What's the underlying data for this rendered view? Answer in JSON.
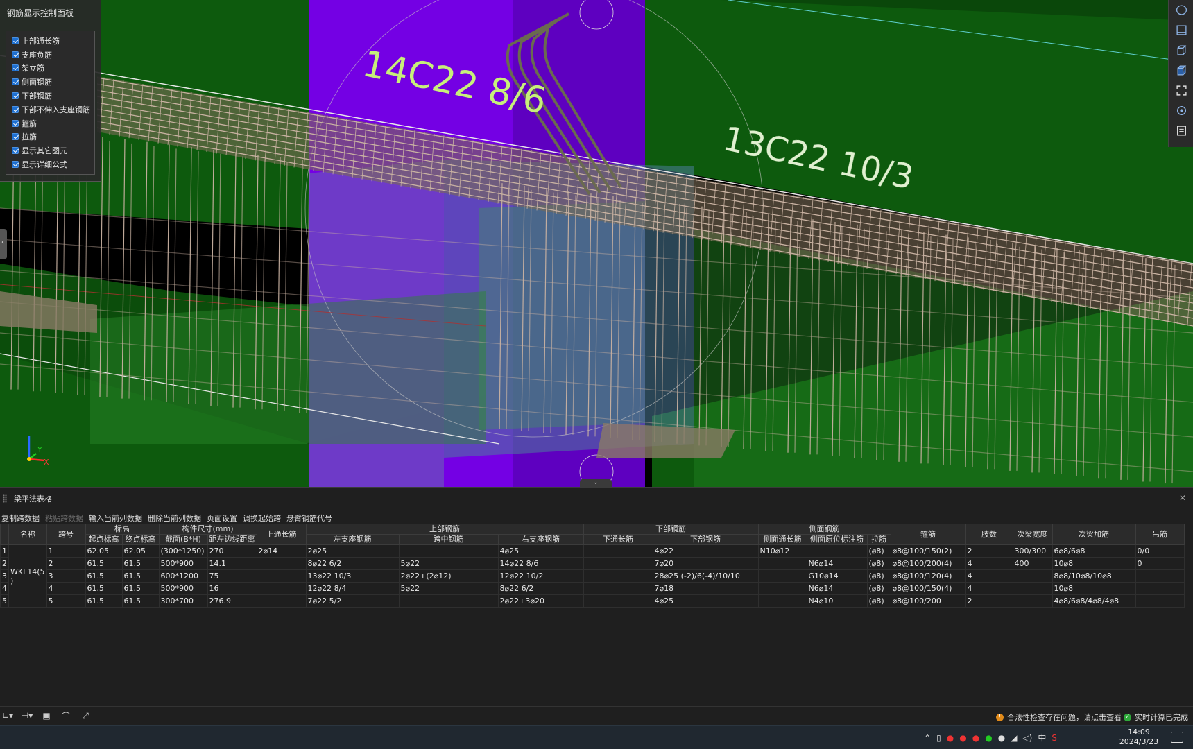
{
  "control_panel": {
    "title": "钢筋显示控制面板",
    "items": [
      {
        "label": "上部通长筋"
      },
      {
        "label": "支座负筋"
      },
      {
        "label": "架立筋"
      },
      {
        "label": "侧面钢筋"
      },
      {
        "label": "下部钢筋"
      },
      {
        "label": "下部不伸入支座钢筋"
      },
      {
        "label": "箍筋"
      },
      {
        "label": "拉筋"
      },
      {
        "label": "显示其它图元"
      },
      {
        "label": "显示详细公式"
      }
    ]
  },
  "viewport": {
    "label_left": "14C22 8/6",
    "label_right": "13C22 10/3",
    "axis": {
      "y": "Y",
      "x": "X"
    }
  },
  "right_toolbar": {
    "icons": [
      "orbit-icon",
      "view-top-icon",
      "view-3d-icon",
      "view-box-icon",
      "fit-screen-icon",
      "settings-cube-icon",
      "report-icon"
    ]
  },
  "table_panel": {
    "title": "梁平法表格",
    "toolbar": [
      {
        "label": "复制跨数据",
        "enabled": true
      },
      {
        "label": "粘贴跨数据",
        "enabled": false
      },
      {
        "label": "输入当前列数据",
        "enabled": true
      },
      {
        "label": "删除当前列数据",
        "enabled": true
      },
      {
        "label": "页面设置",
        "enabled": true
      },
      {
        "label": "调换起始跨",
        "enabled": true
      },
      {
        "label": "悬臂钢筋代号",
        "enabled": true
      }
    ],
    "group_headers": {
      "name": "名称",
      "span": "跨号",
      "elevation": "标高",
      "size": "构件尺寸(mm)",
      "top_through": "上通长筋",
      "top_rebar": "上部钢筋",
      "bottom_rebar": "下部钢筋",
      "side_rebar": "侧面钢筋",
      "stirrup": "箍筋",
      "legs": "肢数",
      "sec_width": "次梁宽度",
      "sec_add": "次梁加筋",
      "hanger": "吊筋"
    },
    "sub_headers": {
      "start_elev": "起点标高",
      "end_elev": "终点标高",
      "section": "截面(B*H)",
      "edge_dist": "距左边线距离",
      "left_support": "左支座钢筋",
      "mid_span": "跨中钢筋",
      "right_support": "右支座钢筋",
      "bottom_through": "下通长筋",
      "bottom_main": "下部钢筋",
      "side_through": "侧面通长筋",
      "side_original": "侧面原位标注筋",
      "tie": "拉筋"
    },
    "beam_name": "WKL14(5",
    "beam_name_suffix": ")",
    "row_markers": [
      "1",
      "2",
      "3",
      "4",
      "5"
    ],
    "rows": [
      {
        "span": "1",
        "start": "62.05",
        "end": "62.05",
        "section": "(300*1250)",
        "edge": "270",
        "top_through": "2⌀14",
        "left": "2⌀25",
        "mid": "",
        "right": "4⌀25",
        "bot_through": "",
        "bot": "4⌀22",
        "side_through": "N10⌀12",
        "side_orig": "",
        "tie": "(⌀8)",
        "stirrup": "⌀8@100/150(2)",
        "legs": "2",
        "sec_w": "300/300",
        "sec_add": "6⌀8/6⌀8",
        "hanger": "0/0"
      },
      {
        "span": "2",
        "start": "61.5",
        "end": "61.5",
        "section": "500*900",
        "edge": "14.1",
        "top_through": "",
        "left": "8⌀22 6/2",
        "mid": "5⌀22",
        "right": "14⌀22 8/6",
        "bot_through": "",
        "bot": "7⌀20",
        "side_through": "",
        "side_orig": "N6⌀14",
        "tie": "(⌀8)",
        "stirrup": "⌀8@100/200(4)",
        "legs": "4",
        "sec_w": "400",
        "sec_add": "10⌀8",
        "hanger": "0"
      },
      {
        "span": "3",
        "start": "61.5",
        "end": "61.5",
        "section": "600*1200",
        "edge": "75",
        "top_through": "",
        "left": "13⌀22 10/3",
        "mid": "2⌀22+(2⌀12)",
        "right": "12⌀22 10/2",
        "bot_through": "",
        "bot": "28⌀25 (-2)/6(-4)/10/10",
        "side_through": "",
        "side_orig": "G10⌀14",
        "tie": "(⌀8)",
        "stirrup": "⌀8@100/120(4)",
        "legs": "4",
        "sec_w": "",
        "sec_add": "8⌀8/10⌀8/10⌀8",
        "hanger": ""
      },
      {
        "span": "4",
        "start": "61.5",
        "end": "61.5",
        "section": "500*900",
        "edge": "16",
        "top_through": "",
        "left": "12⌀22 8/4",
        "mid": "5⌀22",
        "right": "8⌀22 6/2",
        "bot_through": "",
        "bot": "7⌀18",
        "side_through": "",
        "side_orig": "N6⌀14",
        "tie": "(⌀8)",
        "stirrup": "⌀8@100/150(4)",
        "legs": "4",
        "sec_w": "",
        "sec_add": "10⌀8",
        "hanger": ""
      },
      {
        "span": "5",
        "start": "61.5",
        "end": "61.5",
        "section": "300*700",
        "edge": "276.9",
        "top_through": "",
        "left": "7⌀22 5/2",
        "mid": "",
        "right": "2⌀22+3⌀20",
        "bot_through": "",
        "bot": "4⌀25",
        "side_through": "",
        "side_orig": "N4⌀10",
        "tie": "(⌀8)",
        "stirrup": "⌀8@100/200",
        "legs": "2",
        "sec_w": "",
        "sec_add": "4⌀8/6⌀8/4⌀8/4⌀8",
        "hanger": ""
      }
    ]
  },
  "status": {
    "warning": "合法性检查存在问题，请点击查看",
    "ok": "实时计算已完成"
  },
  "taskbar": {
    "time": "14:09",
    "date": "2024/3/23",
    "ime": "中"
  },
  "colors": {
    "green_slab": "#0e5c0e",
    "purple_column": "#8a00ff",
    "rebar": "#c9b2a2",
    "label": "#c7f07a"
  }
}
